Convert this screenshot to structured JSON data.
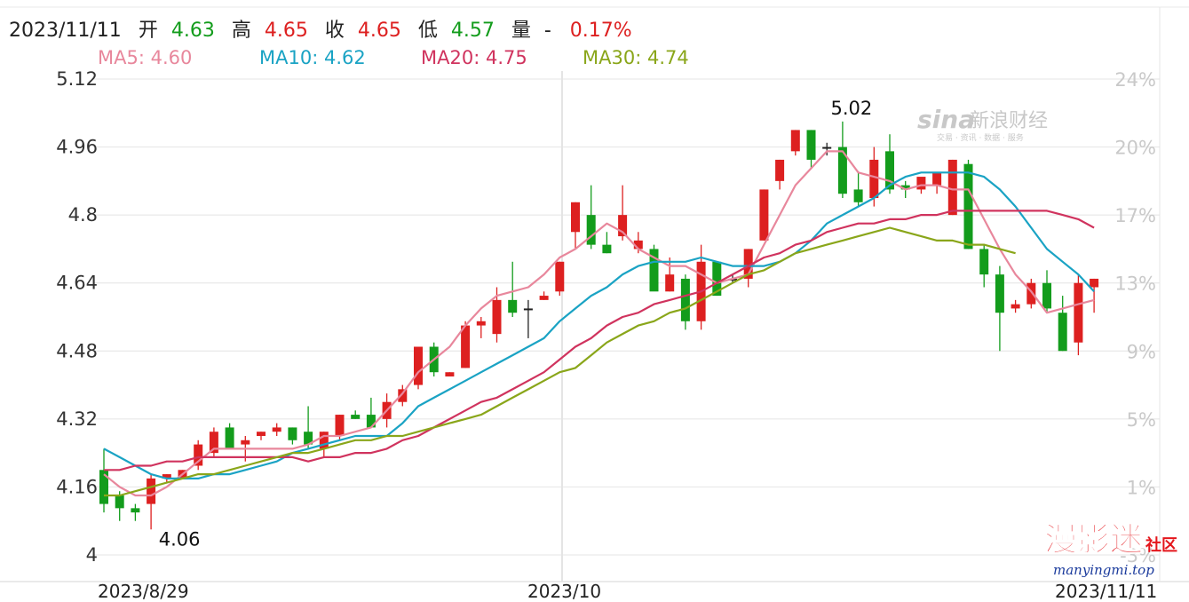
{
  "header": {
    "date": "2023/11/11",
    "open_label": "开",
    "open": "4.63",
    "high_label": "高",
    "high": "4.65",
    "close_label": "收",
    "close": "4.65",
    "low_label": "低",
    "low": "4.57",
    "volume_label": "量",
    "volume": "-",
    "change": "0.17%"
  },
  "ma_legend": [
    {
      "label": "MA5: 4.60",
      "color": "#e8879c"
    },
    {
      "label": "MA10: 4.62",
      "color": "#1aa3c4"
    },
    {
      "label": "MA20: 4.75",
      "color": "#d0335e"
    },
    {
      "label": "MA30: 4.74",
      "color": "#8aa61a"
    }
  ],
  "watermark": {
    "main": "新浪财经",
    "sub": "交易 · 资讯 · 数据 · 服务"
  },
  "badge": {
    "title": "漫影迷",
    "suffix": "社区",
    "url": "manyingmi.top"
  },
  "colors": {
    "up": "#dd2020",
    "down": "#139c1c",
    "grid": "#e4e4e4"
  },
  "chart_data": {
    "type": "candlestick",
    "y_ticks": [
      "5.12",
      "4.96",
      "4.8",
      "4.64",
      "4.48",
      "4.32",
      "4.16",
      "4"
    ],
    "y_range": [
      4.0,
      5.12
    ],
    "pct_ticks": [
      "24%",
      "20%",
      "17%",
      "13%",
      "9%",
      "5%",
      "1%",
      "-3%"
    ],
    "x_ticks": [
      "2023/8/29",
      "2023/10",
      "2023/11/11"
    ],
    "annotations": [
      "5.02",
      "4.06"
    ],
    "candles": [
      [
        4.2,
        4.25,
        4.1,
        4.12
      ],
      [
        4.14,
        4.15,
        4.08,
        4.11
      ],
      [
        4.11,
        4.12,
        4.08,
        4.1
      ],
      [
        4.12,
        4.19,
        4.06,
        4.18
      ],
      [
        4.18,
        4.19,
        4.17,
        4.19
      ],
      [
        4.18,
        4.2,
        4.18,
        4.2
      ],
      [
        4.21,
        4.27,
        4.2,
        4.26
      ],
      [
        4.24,
        4.3,
        4.23,
        4.29
      ],
      [
        4.3,
        4.31,
        4.25,
        4.25
      ],
      [
        4.26,
        4.28,
        4.22,
        4.27
      ],
      [
        4.28,
        4.29,
        4.27,
        4.29
      ],
      [
        4.29,
        4.31,
        4.28,
        4.3
      ],
      [
        4.3,
        4.3,
        4.26,
        4.27
      ],
      [
        4.29,
        4.35,
        4.25,
        4.26
      ],
      [
        4.25,
        4.29,
        4.23,
        4.29
      ],
      [
        4.28,
        4.33,
        4.27,
        4.33
      ],
      [
        4.33,
        4.34,
        4.32,
        4.32
      ],
      [
        4.33,
        4.37,
        4.3,
        4.3
      ],
      [
        4.32,
        4.38,
        4.3,
        4.36
      ],
      [
        4.36,
        4.4,
        4.35,
        4.39
      ],
      [
        4.4,
        4.49,
        4.39,
        4.49
      ],
      [
        4.49,
        4.5,
        4.42,
        4.43
      ],
      [
        4.42,
        4.43,
        4.42,
        4.43
      ],
      [
        4.44,
        4.55,
        4.44,
        4.54
      ],
      [
        4.54,
        4.56,
        4.51,
        4.55
      ],
      [
        4.52,
        4.63,
        4.5,
        4.6
      ],
      [
        4.6,
        4.69,
        4.56,
        4.57
      ],
      [
        4.58,
        4.6,
        4.51,
        4.58
      ],
      [
        4.6,
        4.62,
        4.6,
        4.61
      ],
      [
        4.62,
        4.69,
        4.61,
        4.69
      ],
      [
        4.76,
        4.83,
        4.72,
        4.83
      ],
      [
        4.8,
        4.87,
        4.72,
        4.73
      ],
      [
        4.73,
        4.76,
        4.71,
        4.71
      ],
      [
        4.75,
        4.87,
        4.74,
        4.8
      ],
      [
        4.72,
        4.76,
        4.71,
        4.74
      ],
      [
        4.72,
        4.73,
        4.67,
        4.62
      ],
      [
        4.62,
        4.7,
        4.62,
        4.66
      ],
      [
        4.65,
        4.66,
        4.53,
        4.55
      ],
      [
        4.55,
        4.73,
        4.53,
        4.69
      ],
      [
        4.69,
        4.69,
        4.61,
        4.61
      ],
      [
        4.65,
        4.66,
        4.64,
        4.65
      ],
      [
        4.65,
        4.72,
        4.63,
        4.72
      ],
      [
        4.74,
        4.86,
        4.74,
        4.86
      ],
      [
        4.88,
        4.93,
        4.86,
        4.93
      ],
      [
        4.95,
        5.0,
        4.94,
        5.0
      ],
      [
        5.0,
        5.0,
        4.91,
        4.93
      ],
      [
        4.96,
        4.97,
        4.94,
        4.96
      ],
      [
        4.96,
        5.02,
        4.84,
        4.85
      ],
      [
        4.86,
        4.9,
        4.82,
        4.83
      ],
      [
        4.84,
        4.96,
        4.82,
        4.93
      ],
      [
        4.95,
        4.99,
        4.85,
        4.86
      ],
      [
        4.87,
        4.88,
        4.84,
        4.86
      ],
      [
        4.86,
        4.88,
        4.85,
        4.89
      ],
      [
        4.87,
        4.9,
        4.85,
        4.9
      ],
      [
        4.8,
        4.93,
        4.8,
        4.93
      ],
      [
        4.92,
        4.93,
        4.72,
        4.72
      ],
      [
        4.72,
        4.73,
        4.63,
        4.66
      ],
      [
        4.66,
        4.68,
        4.48,
        4.57
      ],
      [
        4.58,
        4.6,
        4.57,
        4.59
      ],
      [
        4.59,
        4.65,
        4.58,
        4.64
      ],
      [
        4.64,
        4.67,
        4.57,
        4.58
      ],
      [
        4.57,
        4.61,
        4.48,
        4.48
      ],
      [
        4.5,
        4.66,
        4.47,
        4.64
      ],
      [
        4.63,
        4.65,
        4.57,
        4.65
      ]
    ],
    "ma5": [
      4.19,
      4.16,
      4.14,
      4.14,
      4.16,
      4.19,
      4.22,
      4.25,
      4.25,
      4.25,
      4.25,
      4.25,
      4.25,
      4.26,
      4.28,
      4.28,
      4.29,
      4.3,
      4.34,
      4.38,
      4.43,
      4.46,
      4.49,
      4.54,
      4.58,
      4.61,
      4.62,
      4.63,
      4.66,
      4.7,
      4.72,
      4.75,
      4.78,
      4.76,
      4.72,
      4.7,
      4.68,
      4.68,
      4.66,
      4.64,
      4.65,
      4.66,
      4.73,
      4.8,
      4.87,
      4.91,
      4.95,
      4.95,
      4.9,
      4.89,
      4.88,
      4.86,
      4.87,
      4.87,
      4.86,
      4.86,
      4.79,
      4.72,
      4.66,
      4.62,
      4.57,
      4.58,
      4.59,
      4.6
    ],
    "ma10": [
      4.25,
      4.23,
      4.21,
      4.19,
      4.18,
      4.18,
      4.18,
      4.19,
      4.19,
      4.2,
      4.21,
      4.22,
      4.24,
      4.25,
      4.26,
      4.27,
      4.28,
      4.28,
      4.28,
      4.31,
      4.35,
      4.37,
      4.39,
      4.41,
      4.43,
      4.45,
      4.47,
      4.49,
      4.51,
      4.55,
      4.58,
      4.61,
      4.63,
      4.66,
      4.68,
      4.69,
      4.69,
      4.69,
      4.7,
      4.69,
      4.68,
      4.68,
      4.68,
      4.69,
      4.71,
      4.74,
      4.78,
      4.8,
      4.82,
      4.84,
      4.87,
      4.89,
      4.9,
      4.9,
      4.9,
      4.9,
      4.89,
      4.86,
      4.82,
      4.77,
      4.72,
      4.69,
      4.66,
      4.62
    ],
    "ma20": [
      4.2,
      4.2,
      4.21,
      4.21,
      4.22,
      4.22,
      4.23,
      4.23,
      4.23,
      4.23,
      4.23,
      4.23,
      4.23,
      4.22,
      4.23,
      4.23,
      4.24,
      4.24,
      4.25,
      4.27,
      4.28,
      4.3,
      4.32,
      4.34,
      4.36,
      4.37,
      4.39,
      4.41,
      4.43,
      4.46,
      4.49,
      4.51,
      4.54,
      4.56,
      4.57,
      4.59,
      4.6,
      4.61,
      4.62,
      4.64,
      4.66,
      4.68,
      4.7,
      4.71,
      4.73,
      4.74,
      4.76,
      4.77,
      4.78,
      4.78,
      4.79,
      4.79,
      4.8,
      4.8,
      4.81,
      4.81,
      4.81,
      4.81,
      4.81,
      4.81,
      4.81,
      4.8,
      4.79,
      4.77
    ],
    "ma30": [
      4.14,
      4.14,
      4.15,
      4.16,
      4.17,
      4.18,
      4.19,
      4.19,
      4.2,
      4.21,
      4.22,
      4.23,
      4.24,
      4.24,
      4.25,
      4.26,
      4.27,
      4.27,
      4.28,
      4.28,
      4.29,
      4.3,
      4.31,
      4.32,
      4.33,
      4.35,
      4.37,
      4.39,
      4.41,
      4.43,
      4.44,
      4.47,
      4.5,
      4.52,
      4.54,
      4.55,
      4.57,
      4.58,
      4.6,
      4.62,
      4.64,
      4.66,
      4.67,
      4.69,
      4.71,
      4.72,
      4.73,
      4.74,
      4.75,
      4.76,
      4.77,
      4.76,
      4.75,
      4.74,
      4.74,
      4.73,
      4.73,
      4.72,
      4.71
    ]
  }
}
